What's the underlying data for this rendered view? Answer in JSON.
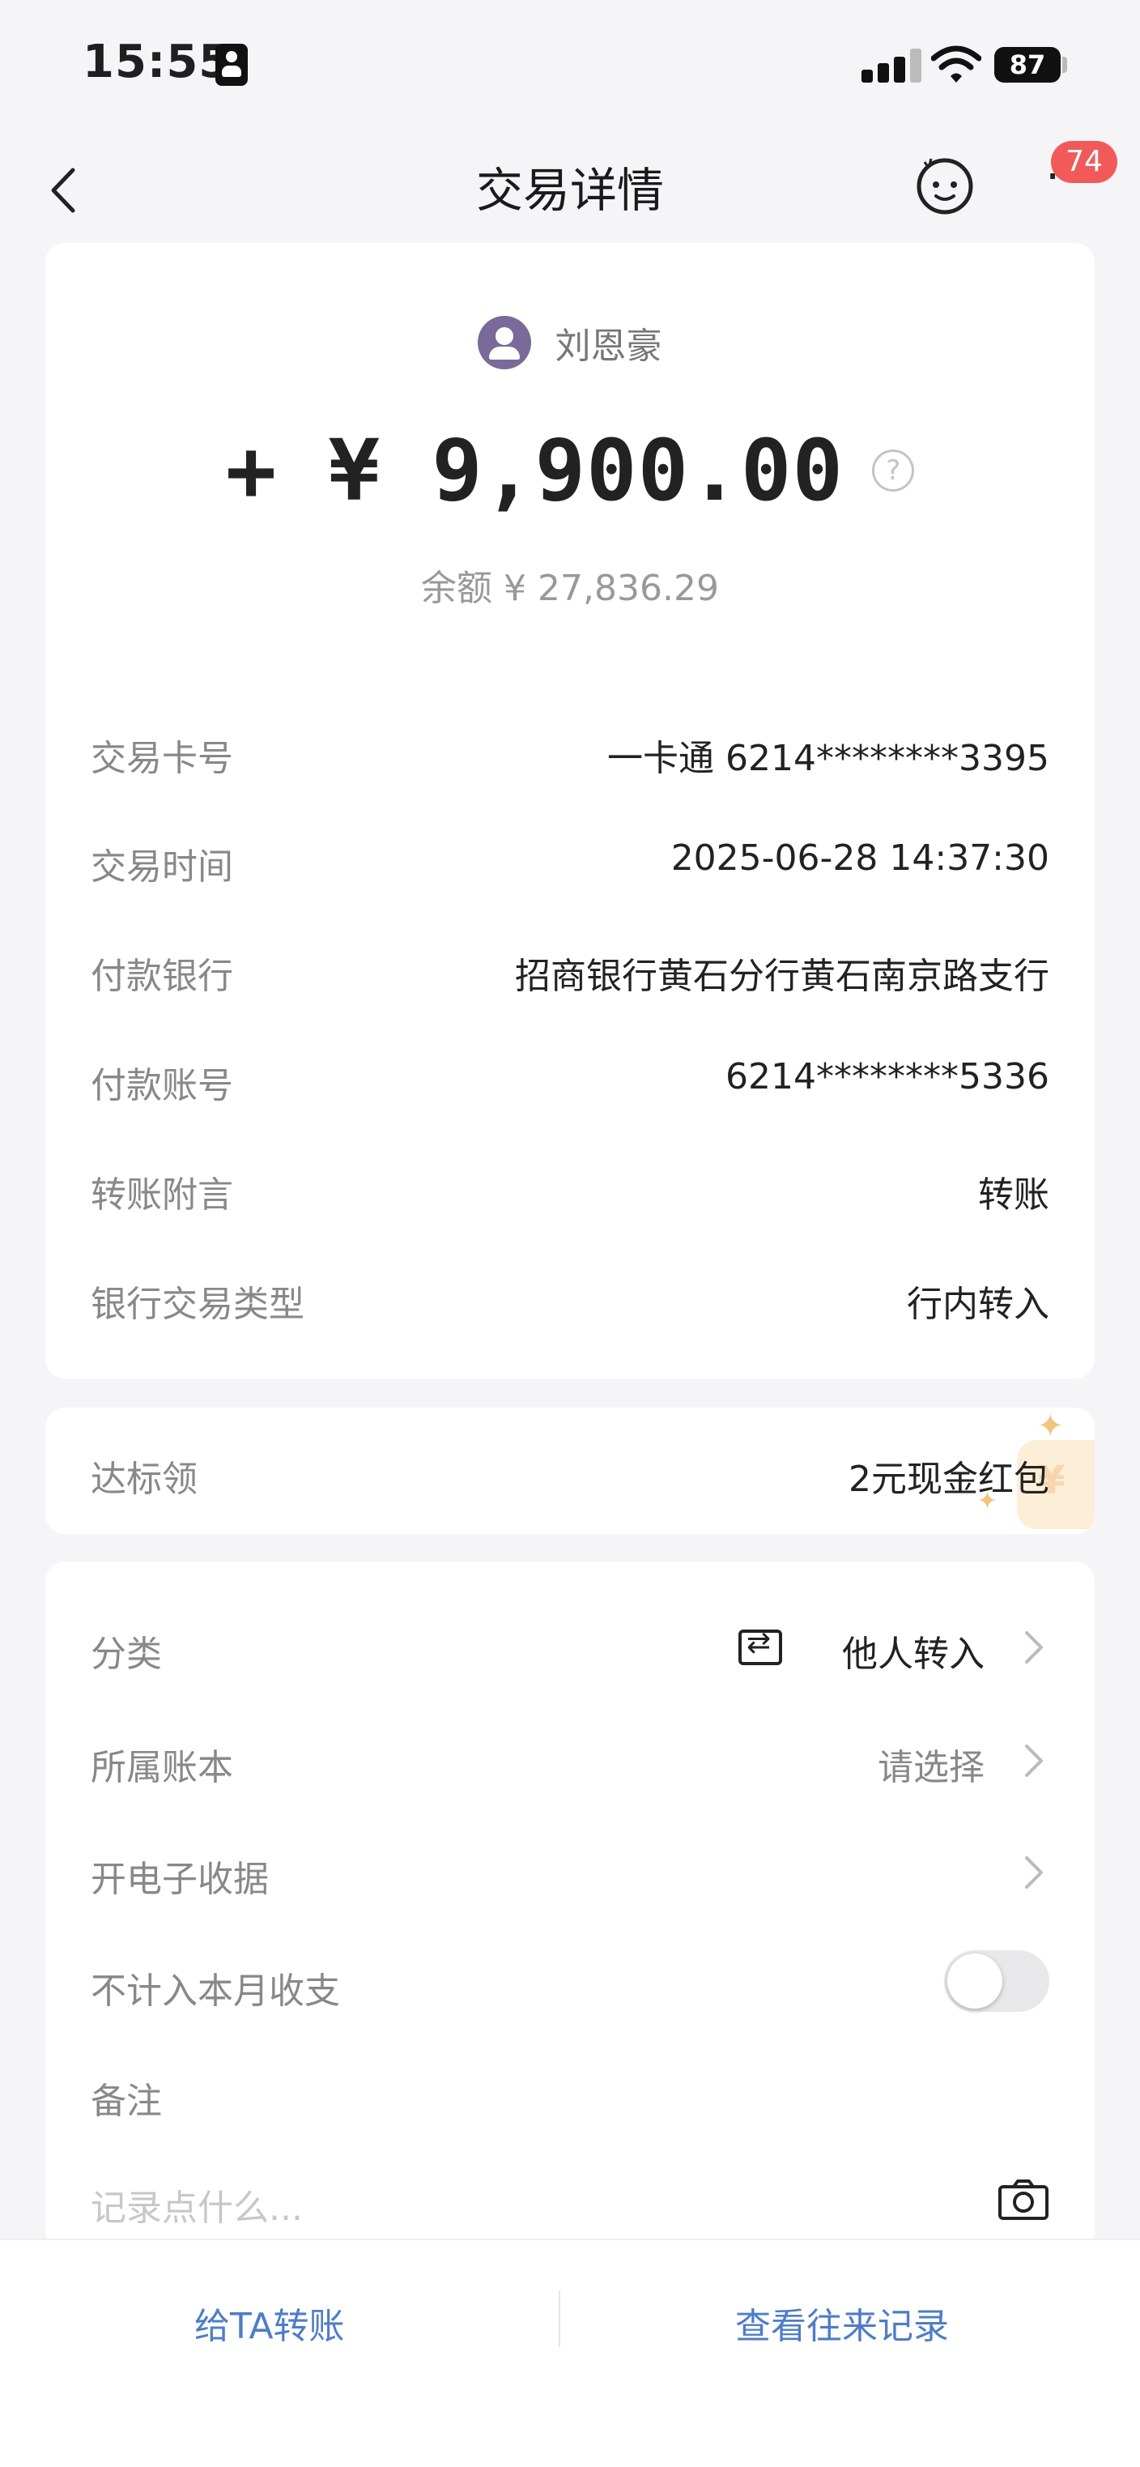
{
  "status_bar": {
    "time": "15:55",
    "battery": "87"
  },
  "nav": {
    "title": "交易详情",
    "badge_count": "74",
    "more_label": "···"
  },
  "transaction": {
    "payer_name": "刘恩豪",
    "amount": "+ ¥ 9,900.00",
    "balance": "余额 ¥ 27,836.29",
    "details": [
      {
        "label": "交易卡号",
        "value": "一卡通 6214********3395"
      },
      {
        "label": "交易时间",
        "value": "2025-06-28 14:37:30"
      },
      {
        "label": "付款银行",
        "value": "招商银行黄石分行黄石南京路支行"
      },
      {
        "label": "付款账号",
        "value": "6214********5336"
      },
      {
        "label": "转账附言",
        "value": "转账"
      },
      {
        "label": "银行交易类型",
        "value": "行内转入"
      }
    ]
  },
  "promo": {
    "label": "达标领",
    "value": "2元现金红包",
    "deco_symbol": "¥"
  },
  "settings": {
    "category": {
      "label": "分类",
      "value": "他人转入"
    },
    "ledger": {
      "label": "所属账本",
      "value": "请选择"
    },
    "receipt": {
      "label": "开电子收据"
    },
    "exclude": {
      "label": "不计入本月收支",
      "enabled": false
    },
    "note": {
      "label": "备注",
      "placeholder": "记录点什么..."
    }
  },
  "bottom_bar": {
    "transfer_label": "给TA转账",
    "history_label": "查看往来记录"
  },
  "colors": {
    "accent_blue": "#4f7dc7",
    "badge_red": "#f25a5a",
    "avatar_purple": "#7a6a9a"
  }
}
